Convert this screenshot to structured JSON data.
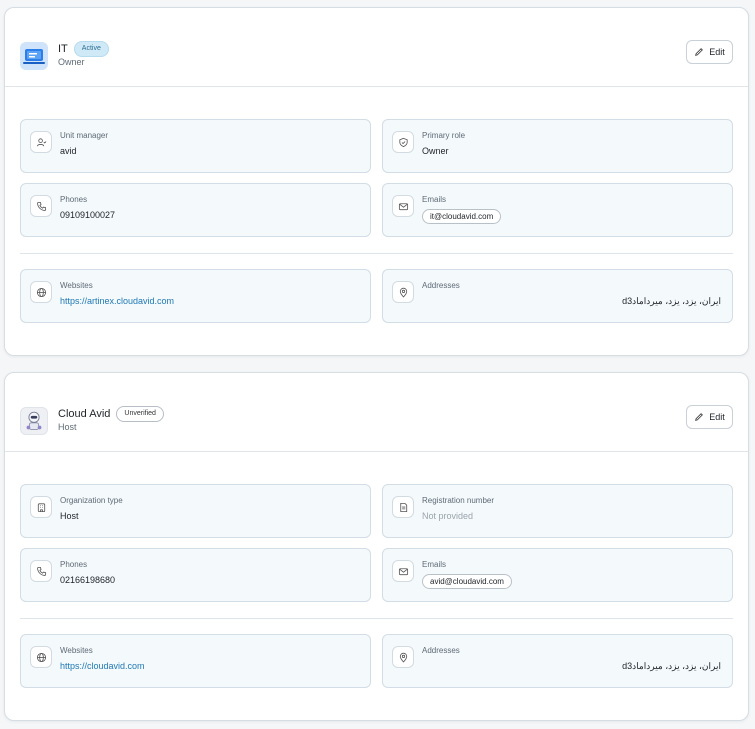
{
  "cards": [
    {
      "title": "IT",
      "badge": "Active",
      "subtitle": "Owner",
      "edit_label": "Edit",
      "tiles": {
        "a": {
          "label": "Unit manager",
          "value": "avid"
        },
        "b": {
          "label": "Primary role",
          "value": "Owner"
        },
        "phones": {
          "label": "Phones",
          "value": "09109100027"
        },
        "emails": {
          "label": "Emails",
          "value": "it@cloudavid.com"
        },
        "websites": {
          "label": "Websites",
          "value": "https://artinex.cloudavid.com"
        },
        "addresses": {
          "label": "Addresses",
          "value": "ایران، یزد، یزد، میردامادd3"
        }
      }
    },
    {
      "title": "Cloud Avid",
      "badge": "Unverified",
      "subtitle": "Host",
      "edit_label": "Edit",
      "tiles": {
        "a": {
          "label": "Organization type",
          "value": "Host"
        },
        "b": {
          "label": "Registration number",
          "value": "Not provided"
        },
        "phones": {
          "label": "Phones",
          "value": "02166198680"
        },
        "emails": {
          "label": "Emails",
          "value": "avid@cloudavid.com"
        },
        "websites": {
          "label": "Websites",
          "value": "https://cloudavid.com"
        },
        "addresses": {
          "label": "Addresses",
          "value": "ایران، یزد، یزد، میردامادd3"
        }
      }
    }
  ],
  "colors": {
    "link": "#1f78b4",
    "active_badge": "#cfe9f7",
    "tile_bg": "#f4f9fc"
  },
  "icons": {
    "card1": [
      "laptop-icon",
      "user-check-icon",
      "shield-icon",
      "phone-icon",
      "mail-icon",
      "globe-icon",
      "map-pin-icon",
      "pencil-icon"
    ],
    "card2": [
      "robot-avatar-icon",
      "building-icon",
      "file-icon",
      "phone-icon",
      "mail-icon",
      "globe-icon",
      "map-pin-icon",
      "pencil-icon"
    ]
  }
}
